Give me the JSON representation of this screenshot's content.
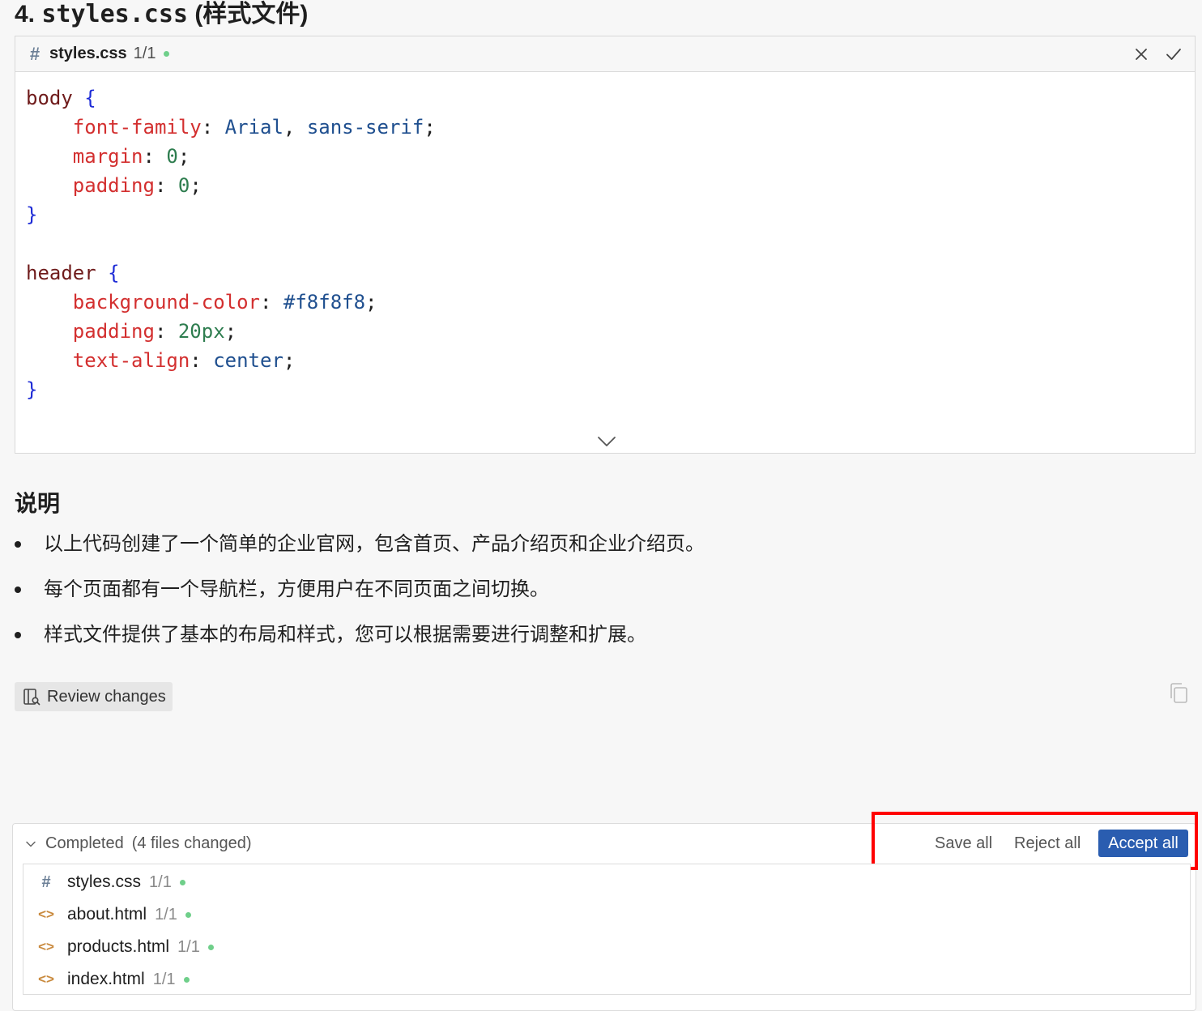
{
  "section": {
    "number": "4.",
    "file": "styles.css",
    "subtitle": "(样式文件)"
  },
  "code_card": {
    "file_icon": "hash-icon",
    "file_name": "styles.css",
    "count": "1/1",
    "close_icon": "close-icon",
    "accept_icon": "check-icon",
    "expand_icon": "chevron-down-icon",
    "lines": [
      [
        {
          "t": "body",
          "c": "sel"
        },
        {
          "t": " ",
          "c": "punct"
        },
        {
          "t": "{",
          "c": "brace"
        }
      ],
      [
        {
          "t": "    ",
          "c": "punct"
        },
        {
          "t": "font-family",
          "c": "prop"
        },
        {
          "t": ": ",
          "c": "punct"
        },
        {
          "t": "Arial",
          "c": "val"
        },
        {
          "t": ", ",
          "c": "punct"
        },
        {
          "t": "sans-serif",
          "c": "val"
        },
        {
          "t": ";",
          "c": "punct"
        }
      ],
      [
        {
          "t": "    ",
          "c": "punct"
        },
        {
          "t": "margin",
          "c": "prop"
        },
        {
          "t": ": ",
          "c": "punct"
        },
        {
          "t": "0",
          "c": "num"
        },
        {
          "t": ";",
          "c": "punct"
        }
      ],
      [
        {
          "t": "    ",
          "c": "punct"
        },
        {
          "t": "padding",
          "c": "prop"
        },
        {
          "t": ": ",
          "c": "punct"
        },
        {
          "t": "0",
          "c": "num"
        },
        {
          "t": ";",
          "c": "punct"
        }
      ],
      [
        {
          "t": "}",
          "c": "brace"
        }
      ],
      [],
      [
        {
          "t": "header",
          "c": "sel"
        },
        {
          "t": " ",
          "c": "punct"
        },
        {
          "t": "{",
          "c": "brace"
        }
      ],
      [
        {
          "t": "    ",
          "c": "punct"
        },
        {
          "t": "background-color",
          "c": "prop"
        },
        {
          "t": ": ",
          "c": "punct"
        },
        {
          "t": "#f8f8f8",
          "c": "val"
        },
        {
          "t": ";",
          "c": "punct"
        }
      ],
      [
        {
          "t": "    ",
          "c": "punct"
        },
        {
          "t": "padding",
          "c": "prop"
        },
        {
          "t": ": ",
          "c": "punct"
        },
        {
          "t": "20px",
          "c": "num"
        },
        {
          "t": ";",
          "c": "punct"
        }
      ],
      [
        {
          "t": "    ",
          "c": "punct"
        },
        {
          "t": "text-align",
          "c": "prop"
        },
        {
          "t": ": ",
          "c": "punct"
        },
        {
          "t": "center",
          "c": "val"
        },
        {
          "t": ";",
          "c": "punct"
        }
      ],
      [
        {
          "t": "}",
          "c": "brace"
        }
      ]
    ]
  },
  "explanation": {
    "heading": "说明",
    "bullets": [
      "以上代码创建了一个简单的企业官网，包含首页、产品介绍页和企业介绍页。",
      "每个页面都有一个导航栏，方便用户在不同页面之间切换。",
      "样式文件提供了基本的布局和样式，您可以根据需要进行调整和扩展。"
    ]
  },
  "review": {
    "label": "Review changes",
    "icon": "review-icon",
    "copy_icon": "copy-icon"
  },
  "completed": {
    "status": "Completed",
    "count_label": "(4 files changed)",
    "save_all": "Save all",
    "reject_all": "Reject all",
    "accept_all": "Accept all",
    "files": [
      {
        "name": "styles.css",
        "count": "1/1",
        "icon": "hash-icon"
      },
      {
        "name": "about.html",
        "count": "1/1",
        "icon": "code-tag-icon"
      },
      {
        "name": "products.html",
        "count": "1/1",
        "icon": "code-tag-icon"
      },
      {
        "name": "index.html",
        "count": "1/1",
        "icon": "code-tag-icon"
      }
    ]
  },
  "colors": {
    "accent": "#2a5db0",
    "highlight": "#ff0000",
    "status_dot": "#6fcf8a"
  }
}
